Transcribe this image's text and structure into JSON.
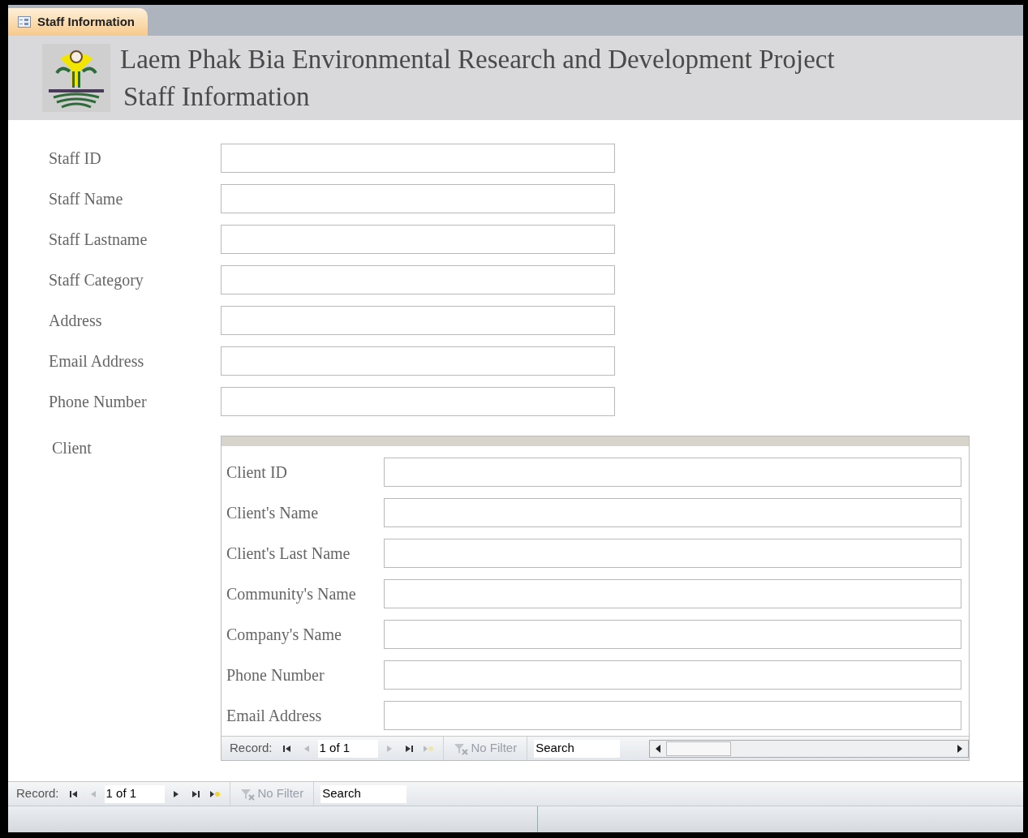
{
  "tab": {
    "label": "Staff Information",
    "selected": true
  },
  "header": {
    "title": "Laem Phak Bia Environmental Research and Development Project",
    "subtitle": "Staff Information"
  },
  "fields": [
    {
      "label": "Staff ID"
    },
    {
      "label": "Staff Name"
    },
    {
      "label": "Staff Lastname"
    },
    {
      "label": "Staff Category"
    },
    {
      "label": "Address"
    },
    {
      "label": "Email Address"
    },
    {
      "label": "Phone Number"
    }
  ],
  "subform": {
    "label": "Client",
    "fields": [
      {
        "label": "Client ID"
      },
      {
        "label": "Client's Name"
      },
      {
        "label": "Client's Last Name"
      },
      {
        "label": "Community's Name"
      },
      {
        "label": "Company's Name"
      },
      {
        "label": "Phone Number"
      },
      {
        "label": "Email Address"
      }
    ],
    "navigator": {
      "label": "Record:",
      "position": "1 of 1",
      "buttons": [
        {
          "kind": "first",
          "disabled": false
        },
        {
          "kind": "prev",
          "disabled": true
        },
        {
          "kind": "next",
          "disabled": true
        },
        {
          "kind": "last",
          "disabled": false
        },
        {
          "kind": "new",
          "disabled": true
        }
      ],
      "filter": "No Filter",
      "search": "Search"
    }
  },
  "navigator": {
    "label": "Record:",
    "position": "1 of 1",
    "buttons": [
      {
        "kind": "first",
        "disabled": false
      },
      {
        "kind": "prev",
        "disabled": true
      },
      {
        "kind": "next",
        "disabled": false
      },
      {
        "kind": "last",
        "disabled": false
      },
      {
        "kind": "new",
        "disabled": false
      }
    ],
    "filter": "No Filter",
    "search": "Search"
  }
}
